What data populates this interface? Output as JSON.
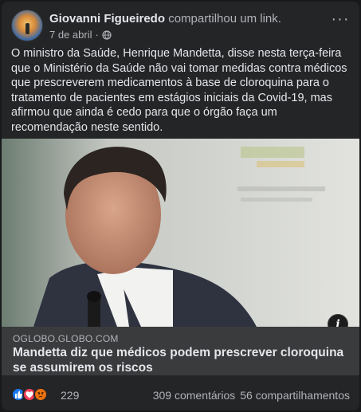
{
  "post": {
    "author": "Giovanni Figueiredo",
    "action": "compartilhou um link.",
    "date": "7 de abril",
    "separator": "·",
    "privacy_icon": "globe-icon",
    "more_icon": "more-horizontal-icon",
    "more_label": "···",
    "text": "O ministro da Saúde, Henrique Mandetta, disse nesta terça-feira que o Ministério da Saúde não vai tomar medidas contra médicos que prescreverem medicamentos à base de cloroquina para o tratamento de pacientes em estágios iniciais da Covid-19, mas afirmou que ainda é cedo para que o órgão faça um recomendação neste sentido."
  },
  "link": {
    "domain": "OGLOBO.GLOBO.COM",
    "title": "Mandetta diz que médicos podem prescrever cloroquina se assumirem os riscos",
    "info_label": "i"
  },
  "footer": {
    "reactions": [
      "like",
      "love",
      "angry"
    ],
    "reaction_count": "229",
    "comments": "309 comentários",
    "shares": "56 compartilhamentos"
  },
  "colors": {
    "card_bg": "#242526",
    "caption_bg": "#3a3b3c",
    "primary_text": "#e4e6eb",
    "secondary_text": "#b0b3b8",
    "like_blue": "#1877f2",
    "love_red": "#f33e58",
    "angry_orange": "#e9710f"
  }
}
